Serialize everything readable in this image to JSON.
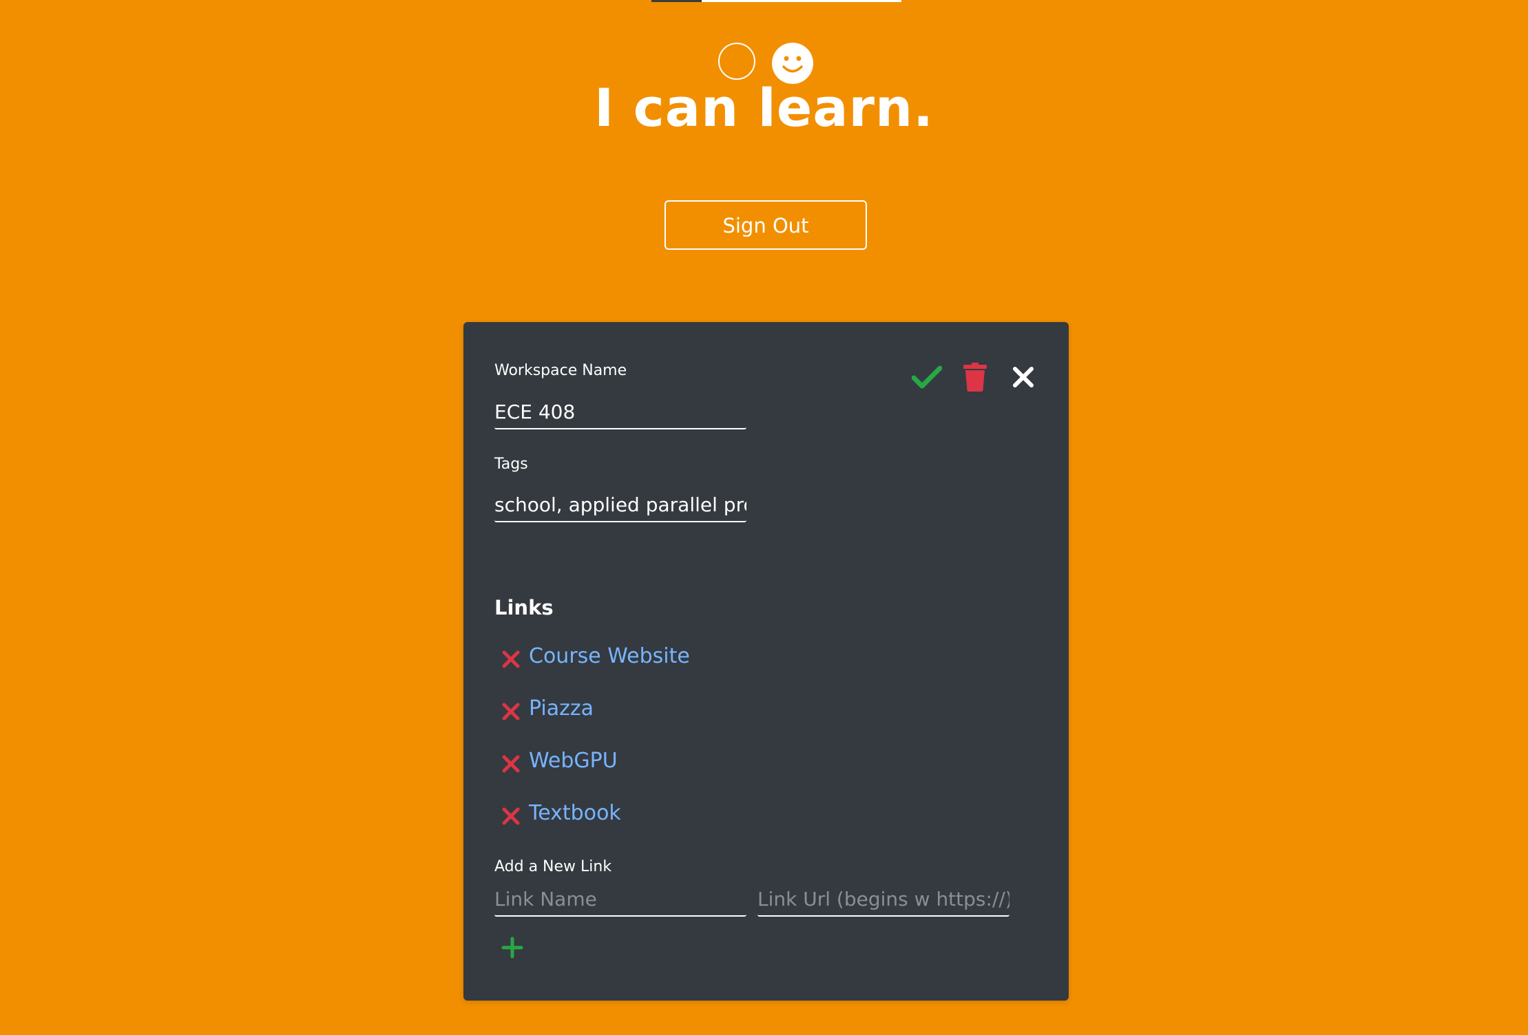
{
  "progress": {
    "fraction": 0.2
  },
  "mood": {
    "icons": [
      "empty-circle-icon",
      "smiley-face-icon"
    ]
  },
  "header": {
    "title": "I can learn."
  },
  "auth": {
    "sign_out_label": "Sign Out"
  },
  "workspace": {
    "name_label": "Workspace Name",
    "name_value": "ECE 408",
    "tags_label": "Tags",
    "tags_value": "school, applied parallel programming",
    "actions": [
      "check-icon",
      "trash-icon",
      "close-icon"
    ]
  },
  "links": {
    "heading": "Links",
    "items": [
      {
        "label": "Course Website"
      },
      {
        "label": "Piazza"
      },
      {
        "label": "WebGPU"
      },
      {
        "label": "Textbook"
      }
    ]
  },
  "new_link": {
    "label": "Add a New Link",
    "name_placeholder": "Link Name",
    "url_placeholder": "Link Url (begins w https://)",
    "add_icon": "plus-icon"
  },
  "colors": {
    "background": "#F28F00",
    "card": "#343A40",
    "confirm": "#28A745",
    "danger": "#DC3545",
    "link": "#78B4FF"
  }
}
